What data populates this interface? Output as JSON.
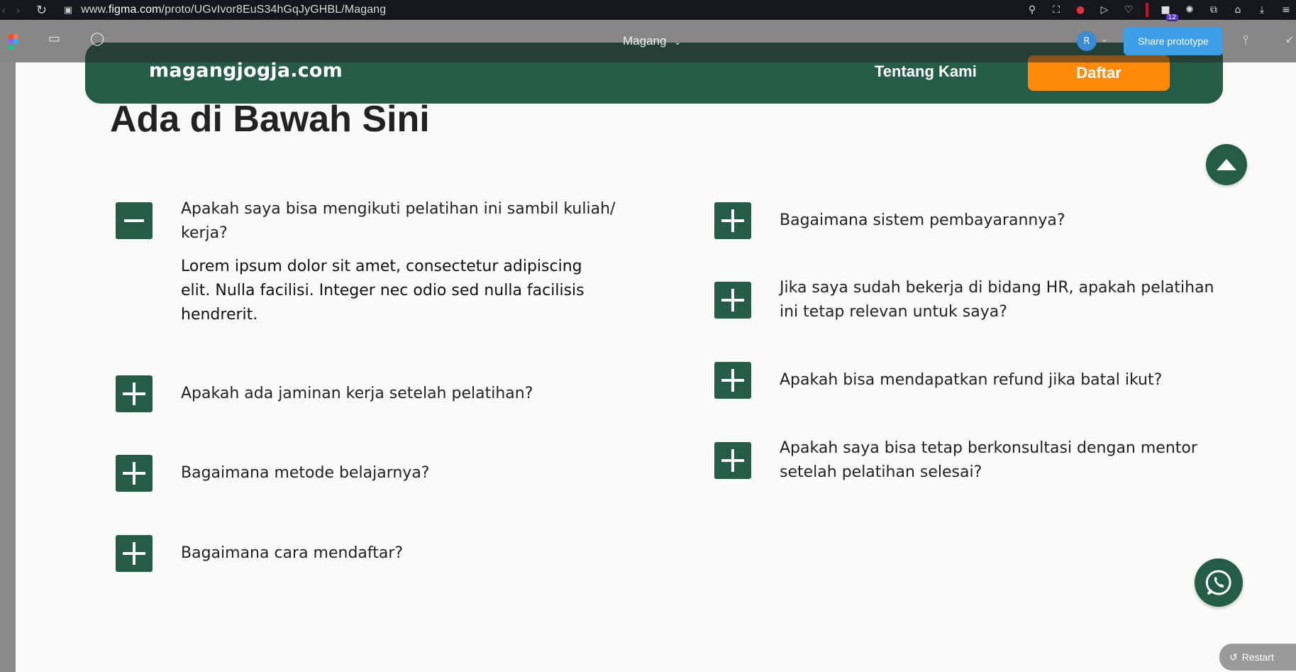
{
  "browser": {
    "url_prefix": "www.",
    "url_domain": "figma.com",
    "url_path": "/proto/UGvIvor8EuS34hGqJyGHBL/Magang",
    "extension_badge": "12"
  },
  "figma": {
    "file_name": "Magang",
    "avatar_initial": "R",
    "share_label": "Share prototype",
    "restart_label": "Restart"
  },
  "site": {
    "logo": "magangjogja.com",
    "nav_about": "Tentang Kami",
    "register_label": "Daftar"
  },
  "section": {
    "title": "Ada di Bawah Sini"
  },
  "faq": {
    "left": [
      {
        "question_line1": "Apakah saya bisa mengikuti pelatihan ini sambil kuliah/",
        "question_line2": "kerja?",
        "expanded": true,
        "answer_line1": "Lorem ipsum dolor sit amet, consectetur adipiscing",
        "answer_line2": "elit. Nulla facilisi. Integer nec odio sed nulla facilisis",
        "answer_line3": "hendrerit."
      },
      {
        "question": "Apakah ada jaminan kerja setelah pelatihan?",
        "expanded": false
      },
      {
        "question": "Bagaimana metode belajarnya?",
        "expanded": false
      },
      {
        "question": "Bagaimana cara mendaftar?",
        "expanded": false
      }
    ],
    "right": [
      {
        "question": "Bagaimana sistem pembayarannya?",
        "expanded": false
      },
      {
        "question_line1": "Jika saya sudah bekerja di bidang HR, apakah pelatihan",
        "question_line2": "ini tetap relevan untuk saya?",
        "expanded": false
      },
      {
        "question": "Apakah bisa mendapatkan refund jika batal ikut?",
        "expanded": false
      },
      {
        "question_line1": "Apakah saya bisa tetap berkonsultasi dengan mentor",
        "question_line2": "setelah pelatihan selesai?",
        "expanded": false
      }
    ]
  },
  "colors": {
    "brand_green": "#245c47",
    "accent_orange": "#ff8a0a",
    "share_blue": "#3b9ee6"
  }
}
